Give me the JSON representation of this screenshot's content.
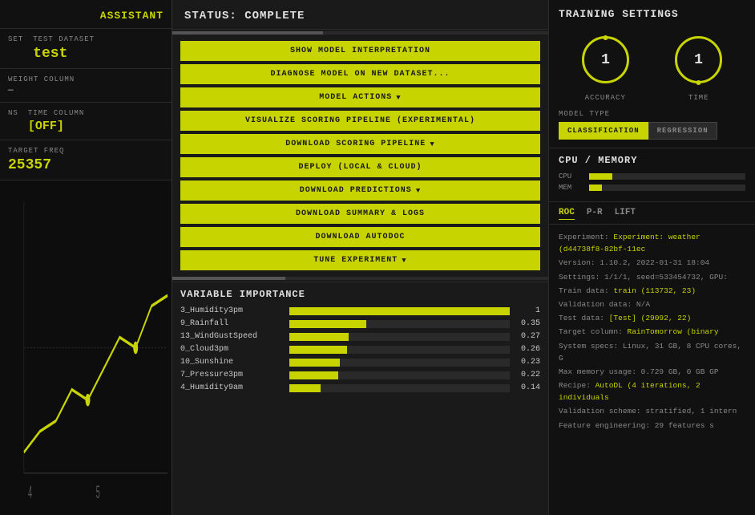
{
  "sidebar": {
    "assistant_label": "ASSISTANT",
    "dataset_label": "SET",
    "test_dataset_label": "TEST DATASET",
    "test_dataset_value": "test",
    "weight_column_label": "WEIGHT COLUMN",
    "weight_column_value": "—",
    "time_column_label": "TIME COLUMN",
    "time_column_value": "[OFF]",
    "target_freq_label": "TARGET FREQ",
    "target_freq_value": "25357",
    "chart_axis_4": "4",
    "chart_axis_5": "5"
  },
  "main": {
    "status": "STATUS: COMPLETE",
    "buttons": [
      {
        "id": "show-model",
        "label": "SHOW MODEL INTERPRETATION",
        "dropdown": false
      },
      {
        "id": "diagnose",
        "label": "DIAGNOSE MODEL ON NEW DATASET...",
        "dropdown": false
      },
      {
        "id": "model-actions",
        "label": "MODEL ACTIONS",
        "dropdown": true
      },
      {
        "id": "visualize",
        "label": "VISUALIZE SCORING PIPELINE (EXPERIMENTAL)",
        "dropdown": false
      },
      {
        "id": "download-scoring",
        "label": "DOWNLOAD SCORING PIPELINE",
        "dropdown": true
      },
      {
        "id": "deploy",
        "label": "DEPLOY (LOCAL & CLOUD)",
        "dropdown": false
      },
      {
        "id": "download-predictions",
        "label": "DOWNLOAD PREDICTIONS",
        "dropdown": true
      },
      {
        "id": "download-summary",
        "label": "DOWNLOAD SUMMARY & LOGS",
        "dropdown": false
      },
      {
        "id": "download-autodoc",
        "label": "DOWNLOAD AUTODOC",
        "dropdown": false
      },
      {
        "id": "tune",
        "label": "TUNE EXPERIMENT",
        "dropdown": true
      }
    ],
    "variable_importance_title": "VARIABLE IMPORTANCE",
    "variables": [
      {
        "name": "3_Humidity3pm",
        "value": 1.0,
        "bar_pct": 100
      },
      {
        "name": "9_Rainfall",
        "value": 0.35,
        "bar_pct": 35
      },
      {
        "name": "13_WindGustSpeed",
        "value": 0.27,
        "bar_pct": 27
      },
      {
        "name": "0_Cloud3pm",
        "value": 0.26,
        "bar_pct": 26
      },
      {
        "name": "10_Sunshine",
        "value": 0.23,
        "bar_pct": 23
      },
      {
        "name": "7_Pressure3pm",
        "value": 0.22,
        "bar_pct": 22
      },
      {
        "name": "4_Humidity9am",
        "value": 0.14,
        "bar_pct": 14
      }
    ]
  },
  "right": {
    "training_settings_title": "TRAINING SETTINGS",
    "accuracy_dial_value": "1",
    "accuracy_label": "ACCURACY",
    "time_dial_value": "1",
    "time_label": "TIME",
    "model_type_label": "MODEL TYPE",
    "classification_label": "CLASSIFICATION",
    "regression_label": "REGRESSION",
    "cpu_memory_title": "CPU / MEMORY",
    "cpu_label": "CPU",
    "mem_label": "MEM",
    "roc_tab": "ROC",
    "pr_tab": "P-R",
    "lift_tab": "LIFT",
    "experiment_info": {
      "experiment_line": "Experiment: weather (d44738f8-82bf-11ec",
      "version_line": "Version: 1.10.2, 2022-01-31 18:04",
      "settings_line": "Settings: 1/1/1, seed=533454732, GPU:",
      "train_line": "Train data: train (113732, 23)",
      "validation_line": "Validation data: N/A",
      "test_line": "Test data: [Test] (29092, 22)",
      "target_line": "Target column: RainTomorrow (binary",
      "system_line": "System specs: Linux, 31 GB, 8 CPU cores, G",
      "memory_line": "Max memory usage: 0.729 GB, 0 GB GP",
      "recipe_line": "Recipe: AutoDL (4 iterations, 2 individuals",
      "validation_scheme_line": "Validation scheme: stratified, 1 intern",
      "feature_line": "Feature engineering: 29 features s"
    }
  }
}
